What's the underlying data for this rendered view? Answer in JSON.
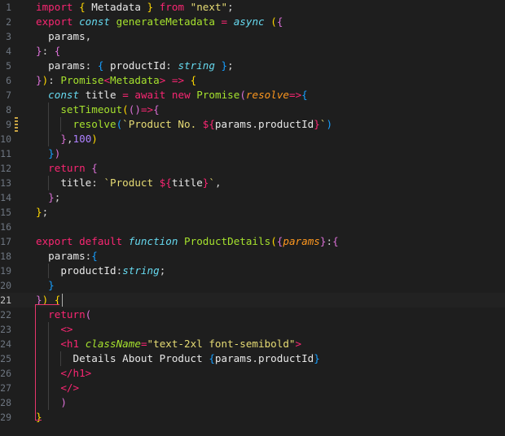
{
  "editor": {
    "language": "typescriptreact",
    "active_line": 21,
    "line_numbers": [
      "1",
      "2",
      "3",
      "4",
      "5",
      "6",
      "7",
      "8",
      "9",
      "10",
      "11",
      "12",
      "13",
      "14",
      "15",
      "16",
      "17",
      "18",
      "19",
      "20",
      "21",
      "22",
      "23",
      "24",
      "25",
      "26",
      "27",
      "28",
      "29"
    ],
    "lines": [
      [
        [
          "kw-import",
          "import"
        ],
        [
          "punc",
          " "
        ],
        [
          "br1",
          "{"
        ],
        [
          "plain",
          " Metadata "
        ],
        [
          "br1",
          "}"
        ],
        [
          "punc",
          " "
        ],
        [
          "kw-import",
          "from"
        ],
        [
          "punc",
          " "
        ],
        [
          "str",
          "\"next\""
        ],
        [
          "punc",
          ";"
        ]
      ],
      [
        [
          "kw",
          "export"
        ],
        [
          "punc",
          " "
        ],
        [
          "storage",
          "const"
        ],
        [
          "punc",
          " "
        ],
        [
          "fn",
          "generateMetadata"
        ],
        [
          "punc",
          " "
        ],
        [
          "kw",
          "="
        ],
        [
          "punc",
          " "
        ],
        [
          "storage",
          "async"
        ],
        [
          "punc",
          " "
        ],
        [
          "br1",
          "("
        ],
        [
          "br2",
          "{"
        ]
      ],
      [
        [
          "punc",
          "  "
        ],
        [
          "plain",
          "params"
        ],
        [
          "punc",
          ","
        ]
      ],
      [
        [
          "br2",
          "}"
        ],
        [
          "punc",
          ": "
        ],
        [
          "br2",
          "{"
        ]
      ],
      [
        [
          "punc",
          "  "
        ],
        [
          "plain",
          "params"
        ],
        [
          "punc",
          ": "
        ],
        [
          "br3",
          "{"
        ],
        [
          "punc",
          " "
        ],
        [
          "plain",
          "productId"
        ],
        [
          "punc",
          ": "
        ],
        [
          "type",
          "string"
        ],
        [
          "punc",
          " "
        ],
        [
          "br3",
          "}"
        ],
        [
          "punc",
          ";"
        ]
      ],
      [
        [
          "br2",
          "}"
        ],
        [
          "br1",
          ")"
        ],
        [
          "punc",
          ": "
        ],
        [
          "cls",
          "Promise"
        ],
        [
          "kw",
          "<"
        ],
        [
          "cls",
          "Metadata"
        ],
        [
          "kw",
          ">"
        ],
        [
          "punc",
          " "
        ],
        [
          "kw",
          "=>"
        ],
        [
          "punc",
          " "
        ],
        [
          "br1",
          "{"
        ]
      ],
      [
        [
          "punc",
          "  "
        ],
        [
          "storage",
          "const"
        ],
        [
          "punc",
          " "
        ],
        [
          "plain",
          "title"
        ],
        [
          "punc",
          " "
        ],
        [
          "kw",
          "="
        ],
        [
          "punc",
          " "
        ],
        [
          "kw",
          "await"
        ],
        [
          "punc",
          " "
        ],
        [
          "kw",
          "new"
        ],
        [
          "punc",
          " "
        ],
        [
          "cls",
          "Promise"
        ],
        [
          "br2",
          "("
        ],
        [
          "param",
          "resolve"
        ],
        [
          "kw",
          "=>"
        ],
        [
          "br3",
          "{"
        ]
      ],
      [
        [
          "punc",
          "    "
        ],
        [
          "fn",
          "setTimeout"
        ],
        [
          "br1",
          "("
        ],
        [
          "br2",
          "()"
        ],
        [
          "kw",
          "=>"
        ],
        [
          "br2",
          "{"
        ]
      ],
      [
        [
          "punc",
          "      "
        ],
        [
          "fn",
          "resolve"
        ],
        [
          "br3",
          "("
        ],
        [
          "tpl",
          "`Product No. "
        ],
        [
          "kw",
          "${"
        ],
        [
          "plain",
          "params"
        ],
        [
          "punc",
          "."
        ],
        [
          "plain",
          "productId"
        ],
        [
          "kw",
          "}"
        ],
        [
          "tpl",
          "`"
        ],
        [
          "br3",
          ")"
        ]
      ],
      [
        [
          "punc",
          "    "
        ],
        [
          "br2",
          "}"
        ],
        [
          "punc",
          ","
        ],
        [
          "num",
          "100"
        ],
        [
          "br1",
          ")"
        ]
      ],
      [
        [
          "punc",
          "  "
        ],
        [
          "br3",
          "}"
        ],
        [
          "br2",
          ")"
        ]
      ],
      [
        [
          "punc",
          "  "
        ],
        [
          "kw",
          "return"
        ],
        [
          "punc",
          " "
        ],
        [
          "br2",
          "{"
        ]
      ],
      [
        [
          "punc",
          "    "
        ],
        [
          "plain",
          "title"
        ],
        [
          "punc",
          ": "
        ],
        [
          "tpl",
          "`Product "
        ],
        [
          "kw",
          "${"
        ],
        [
          "plain",
          "title"
        ],
        [
          "kw",
          "}"
        ],
        [
          "tpl",
          "`"
        ],
        [
          "punc",
          ","
        ]
      ],
      [
        [
          "punc",
          "  "
        ],
        [
          "br2",
          "}"
        ],
        [
          "punc",
          ";"
        ]
      ],
      [
        [
          "br1",
          "}"
        ],
        [
          "punc",
          ";"
        ]
      ],
      [],
      [
        [
          "kw",
          "export"
        ],
        [
          "punc",
          " "
        ],
        [
          "kw",
          "default"
        ],
        [
          "punc",
          " "
        ],
        [
          "storage",
          "function"
        ],
        [
          "punc",
          " "
        ],
        [
          "fn",
          "ProductDetails"
        ],
        [
          "br1",
          "("
        ],
        [
          "br2",
          "{"
        ],
        [
          "param",
          "params"
        ],
        [
          "br2",
          "}"
        ],
        [
          "punc",
          ":"
        ],
        [
          "br2",
          "{"
        ]
      ],
      [
        [
          "punc",
          "  "
        ],
        [
          "plain",
          "params"
        ],
        [
          "punc",
          ":"
        ],
        [
          "br3",
          "{"
        ]
      ],
      [
        [
          "punc",
          "    "
        ],
        [
          "plain",
          "productId"
        ],
        [
          "punc",
          ":"
        ],
        [
          "type",
          "string"
        ],
        [
          "punc",
          ";"
        ]
      ],
      [
        [
          "punc",
          "  "
        ],
        [
          "br3",
          "}"
        ]
      ],
      [
        [
          "br2",
          "}"
        ],
        [
          "br1",
          ")"
        ],
        [
          "punc",
          " "
        ],
        [
          "br1",
          "{"
        ]
      ],
      [
        [
          "punc",
          "  "
        ],
        [
          "kw",
          "return"
        ],
        [
          "br2",
          "("
        ]
      ],
      [
        [
          "punc",
          "    "
        ],
        [
          "tag",
          "<>"
        ]
      ],
      [
        [
          "punc",
          "    "
        ],
        [
          "tag",
          "<h1"
        ],
        [
          "punc",
          " "
        ],
        [
          "attr",
          "className"
        ],
        [
          "kw",
          "="
        ],
        [
          "str",
          "\"text-2xl font-semibold\""
        ],
        [
          "tag",
          ">"
        ]
      ],
      [
        [
          "punc",
          "      "
        ],
        [
          "plain",
          "Details About Product "
        ],
        [
          "br3",
          "{"
        ],
        [
          "plain",
          "params"
        ],
        [
          "punc",
          "."
        ],
        [
          "plain",
          "productId"
        ],
        [
          "br3",
          "}"
        ]
      ],
      [
        [
          "punc",
          "    "
        ],
        [
          "tag",
          "</h1>"
        ]
      ],
      [
        [
          "punc",
          "    "
        ],
        [
          "tag",
          "</>"
        ]
      ],
      [
        [
          "punc",
          "    "
        ],
        [
          "br2",
          ")"
        ]
      ],
      [
        [
          "br1",
          "}"
        ]
      ]
    ]
  }
}
